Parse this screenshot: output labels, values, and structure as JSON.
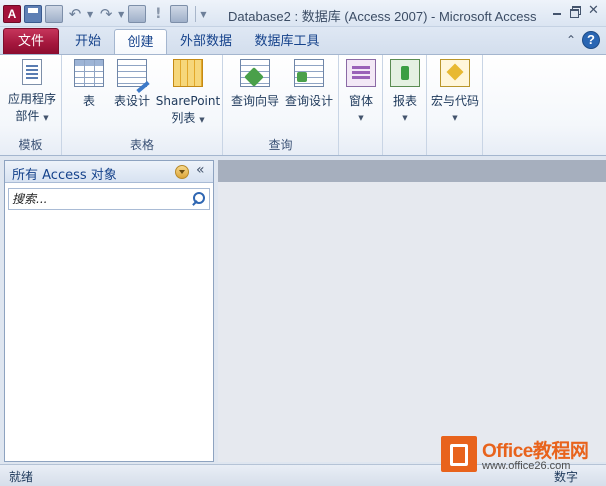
{
  "window": {
    "title": "Database2 : 数据库 (Access 2007)  -  Microsoft Access",
    "app_icon_letter": "A"
  },
  "qat": {
    "icons": [
      "access-app-icon",
      "save-icon",
      "generic-icon",
      "undo-icon",
      "redo-icon",
      "compact-icon",
      "run-icon",
      "datasheet-icon"
    ]
  },
  "tabs": {
    "file": "文件",
    "home": "开始",
    "create": "创建",
    "external": "外部数据",
    "dbtools": "数据库工具",
    "active": "create"
  },
  "ribbon": {
    "groups": {
      "templates": {
        "label": "模板",
        "app_parts_line1": "应用程序",
        "app_parts_line2": "部件"
      },
      "tables": {
        "label": "表格",
        "table": "表",
        "table_design": "表设计",
        "sharepoint_line1": "SharePoint",
        "sharepoint_line2": "列表"
      },
      "queries": {
        "label": "查询",
        "query_wizard": "查询向导",
        "query_design": "查询设计"
      },
      "forms": {
        "label": "窗体"
      },
      "reports": {
        "label": "报表"
      },
      "macros": {
        "label": "宏与代码"
      }
    }
  },
  "nav_pane": {
    "title": "所有 Access 对象",
    "search_placeholder": "搜索...",
    "collapse_glyph": "«"
  },
  "status": {
    "left": "就绪",
    "right": "数字"
  },
  "watermark": {
    "title": "Office教程网",
    "url": "www.office26.com"
  },
  "colors": {
    "file_tab": "#a3163c",
    "accent": "#15428b",
    "watermark": "#e8631c"
  }
}
